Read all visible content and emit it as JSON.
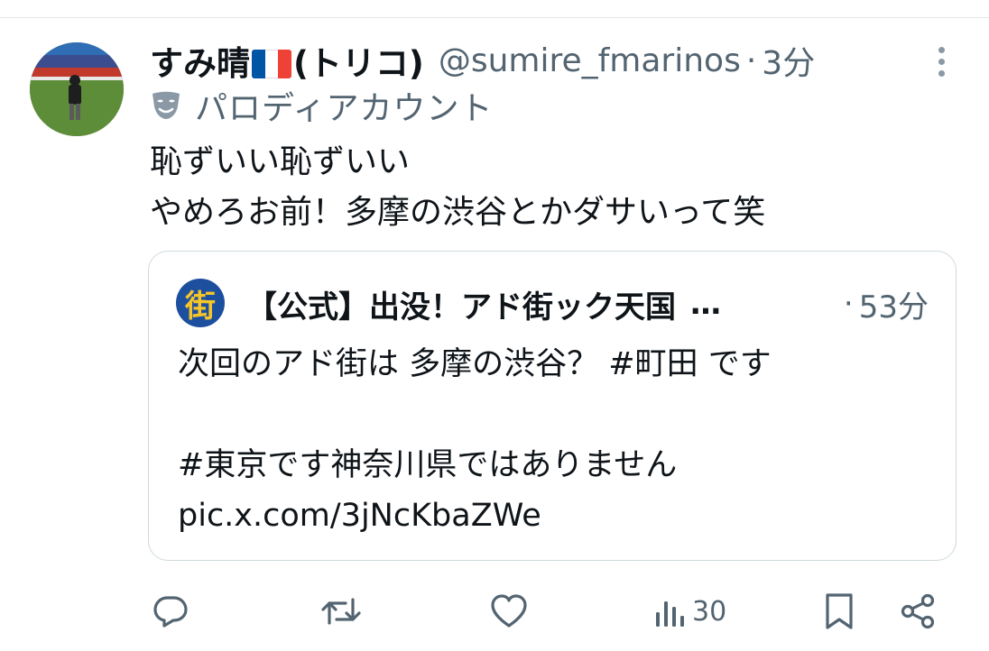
{
  "tweet": {
    "display_name_before_flag": "すみ晴",
    "display_name_after_flag": "(トリコ)",
    "handle": "@sumire_fmarinos",
    "dot": "·",
    "timestamp": "3分",
    "parody_label": "パロディアカウント",
    "text_lines": [
      "恥ずいい恥ずいい",
      "やめろお前！多摩の渋谷とかダサいって笑"
    ],
    "flag_colors": [
      "#0055a4",
      "#ffffff",
      "#ef4135"
    ]
  },
  "quote": {
    "avatar_glyph": "街",
    "name": "【公式】出没！アド街ック天国",
    "ellipsis": "…",
    "dot": "·",
    "timestamp": "53分",
    "lines": [
      "次回のアド街は 多摩の渋谷？ #町田 です",
      "",
      "#東京です神奈川県ではありません",
      "pic.x.com/3jNcKbaZWe"
    ]
  },
  "actions": {
    "reply_icon": "reply-icon",
    "retweet_icon": "retweet-icon",
    "like_icon": "heart-icon",
    "views_icon": "views-icon",
    "views_count": "30",
    "bookmark_icon": "bookmark-icon",
    "share_icon": "share-icon"
  },
  "colors": {
    "text": "#0f1419",
    "secondary": "#536471",
    "border": "#cfd9de"
  }
}
